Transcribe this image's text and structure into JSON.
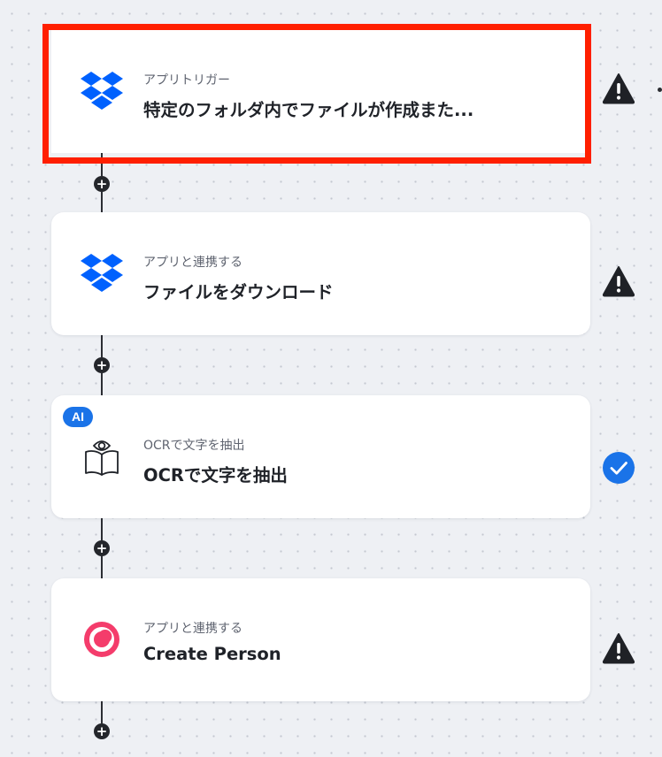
{
  "steps": [
    {
      "kicker": "アプリトリガー",
      "title": "特定のフォルダ内でファイルが作成また...",
      "app_icon": "dropbox-icon",
      "status": "warning",
      "selected": true
    },
    {
      "kicker": "アプリと連携する",
      "title": "ファイルをダウンロード",
      "app_icon": "dropbox-icon",
      "status": "warning",
      "selected": false
    },
    {
      "kicker": "OCRで文字を抽出",
      "title": "OCRで文字を抽出",
      "app_icon": "ocr-book-eye-icon",
      "badge": "AI",
      "status": "complete",
      "selected": false
    },
    {
      "kicker": "アプリと連携する",
      "title": "Create Person",
      "app_icon": "copper-crm-icon",
      "status": "warning",
      "selected": false
    }
  ],
  "add_step_symbol": "+",
  "colors": {
    "selection": "#ff1f00",
    "dropbox": "#0061fe",
    "ai_badge": "#1a73e8",
    "complete": "#1a73e8",
    "warning": "#1f2126",
    "copper": "#f43c6b"
  }
}
